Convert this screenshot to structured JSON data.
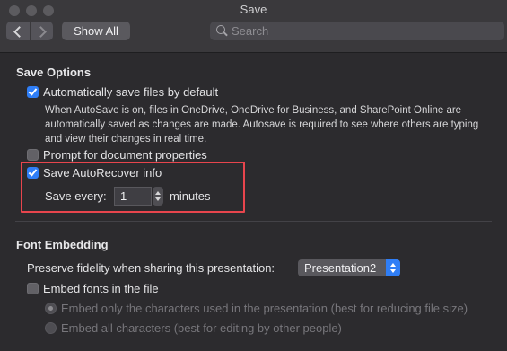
{
  "window": {
    "title": "Save"
  },
  "toolbar": {
    "back_label": "Back",
    "forward_label": "Forward",
    "show_all_label": "Show All",
    "search": {
      "placeholder": "Search",
      "value": ""
    }
  },
  "save_options": {
    "heading": "Save Options",
    "autosave": {
      "label": "Automatically save files by default",
      "checked": true,
      "description": "When AutoSave is on, files in OneDrive, OneDrive for Business, and SharePoint Online are automatically saved as changes are made. Autosave is required to see where others are typing and view their changes in real time."
    },
    "prompt_properties": {
      "label": "Prompt for document properties",
      "checked": false
    },
    "autorecover": {
      "label": "Save AutoRecover info",
      "checked": true,
      "save_every_label": "Save every:",
      "save_every_value": "1",
      "unit_label": "minutes"
    }
  },
  "font_embedding": {
    "heading": "Font Embedding",
    "preserve_label": "Preserve fidelity when sharing this presentation:",
    "presentation_select": {
      "value": "Presentation2"
    },
    "embed_fonts": {
      "label": "Embed fonts in the file",
      "checked": false
    },
    "option_subset": {
      "label": "Embed only the characters used in the presentation (best for reducing file size)",
      "selected": true,
      "enabled": false
    },
    "option_all": {
      "label": "Embed all characters (best for editing by other people)",
      "selected": false,
      "enabled": false
    }
  },
  "colors": {
    "accent": "#2f7ef6",
    "highlight": "#e8454d",
    "background": "#2c2b2e"
  }
}
